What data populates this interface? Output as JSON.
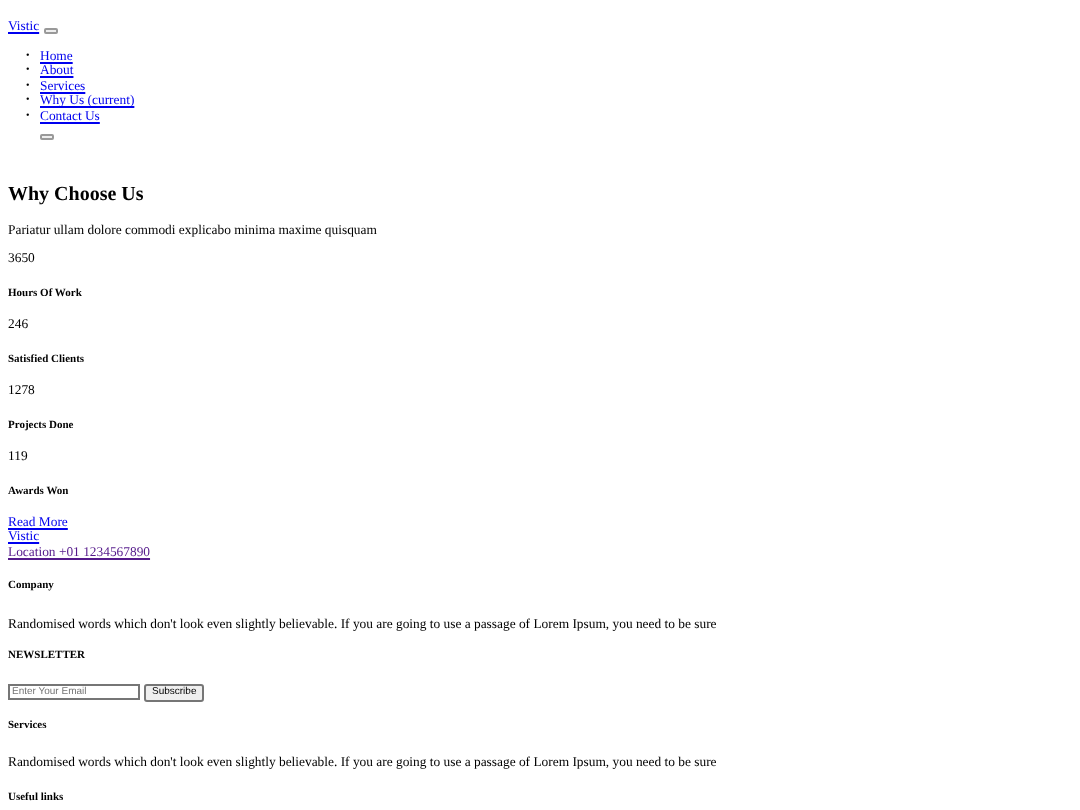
{
  "nav": {
    "brand": "Vistic",
    "items": [
      {
        "marker": "•",
        "label": "Home"
      },
      {
        "marker": "•",
        "label": "About"
      },
      {
        "marker": "•",
        "label": "Services"
      },
      {
        "marker": "•",
        "label": "Why Us (current)"
      },
      {
        "marker": "•",
        "label": "Contact Us"
      }
    ]
  },
  "why": {
    "title": "Why Choose Us",
    "text": "Pariatur ullam dolore commodi explicabo minima maxime quisquam",
    "lines": [
      {
        "kind": "number",
        "text": "3650"
      },
      {
        "kind": "caption",
        "text": "Hours Of Work"
      },
      {
        "kind": "number",
        "text": "246"
      },
      {
        "kind": "caption",
        "text": "Satisfied Clients"
      },
      {
        "kind": "number",
        "text": "1278"
      },
      {
        "kind": "caption",
        "text": "Projects Done"
      },
      {
        "kind": "number",
        "text": "119"
      },
      {
        "kind": "caption",
        "text": "Awards Won"
      }
    ],
    "link": "Read More"
  },
  "footer": {
    "brand": "Vistic",
    "location": "Location +01 1234567890",
    "company_title": "Company",
    "company_text": "Randomised words which don't look even slightly believable. If you are going to use a passage of Lorem Ipsum, you need to be sure",
    "newsletter_title": "NEWSLETTER",
    "email_placeholder": "Enter Your Email",
    "subscribe": "Subscribe",
    "services_title": "Services",
    "services_text": "Randomised words which don't look even slightly believable. If you are going to use a passage of Lorem Ipsum, you need to be sure",
    "links_title": "Useful links"
  }
}
